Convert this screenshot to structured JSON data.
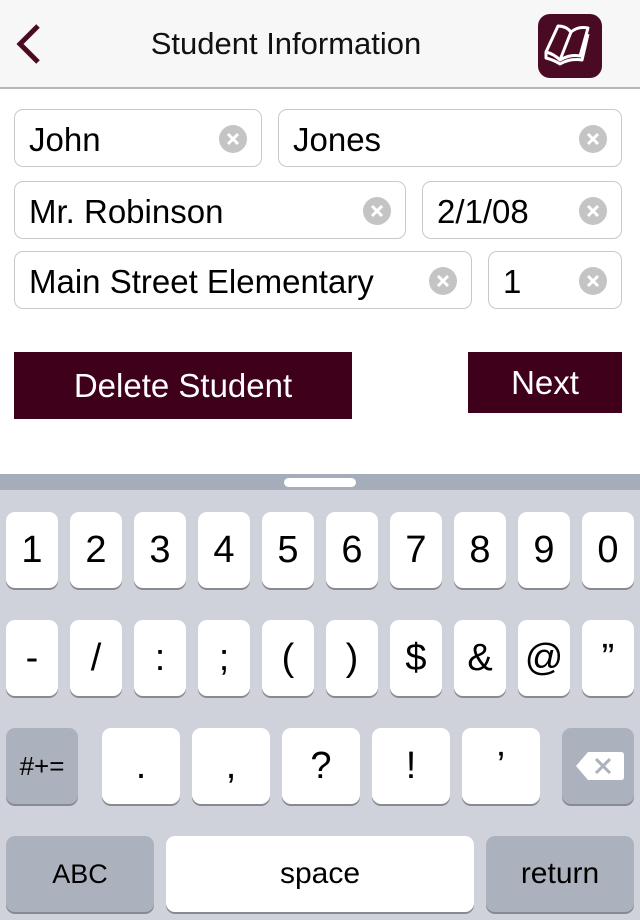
{
  "nav": {
    "title": "Student Information",
    "back_icon": "chevron-left-icon",
    "book_icon": "open-book-icon"
  },
  "colors": {
    "brand": "#3f001b",
    "nav_bg": "#f7f7f7",
    "keyboard_bg": "#cfd2da",
    "key_dark": "#abb2bd"
  },
  "form": {
    "first_name": "John",
    "last_name": "Jones",
    "teacher": "Mr. Robinson",
    "birth_date": "2/1/08",
    "school": "Main Street Elementary",
    "grade": "1"
  },
  "actions": {
    "delete_label": "Delete Student",
    "next_label": "Next"
  },
  "keyboard": {
    "row1": [
      "1",
      "2",
      "3",
      "4",
      "5",
      "6",
      "7",
      "8",
      "9",
      "0"
    ],
    "row2": [
      "-",
      "/",
      ":",
      ";",
      "(",
      ")",
      "$",
      "&",
      "@",
      "”"
    ],
    "row3": [
      ".",
      ",",
      "?",
      "!",
      "’"
    ],
    "symbols_label": "#+=",
    "abc_label": "ABC",
    "space_label": "space",
    "return_label": "return",
    "backspace_icon": "backspace-icon"
  }
}
